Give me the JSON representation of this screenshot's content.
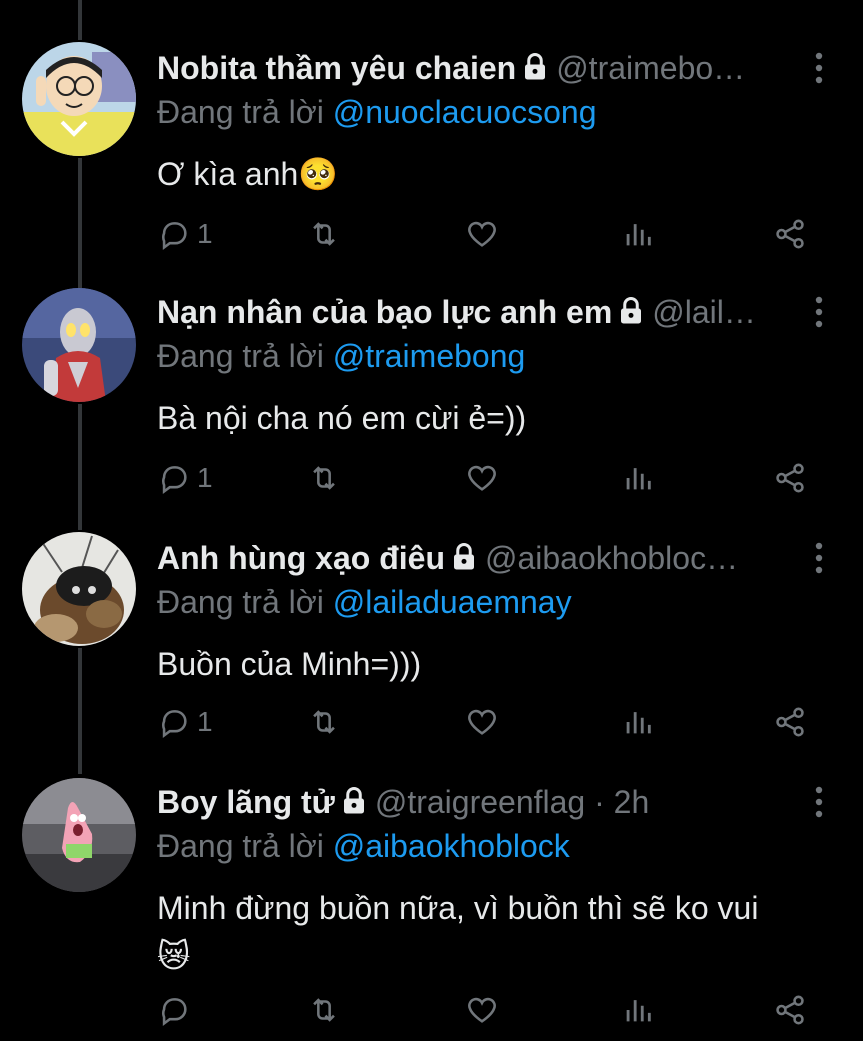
{
  "tweets": [
    {
      "name": "Nobita thầm yêu chaien",
      "handle": "@traimebo…",
      "reply_prefix": "Đang trả lời",
      "reply_to": "@nuoclacuocsong",
      "text": "Ơ kìa anh",
      "emoji": "🥺",
      "reply_count": "1",
      "avatar": "nobita-avatar"
    },
    {
      "name": "Nạn nhân của bạo lực anh em",
      "handle": "@lail…",
      "reply_prefix": "Đang trả lời",
      "reply_to": "@traimebong",
      "text": "Bà nội cha nó em cừi ẻ=))",
      "reply_count": "1",
      "avatar": "ultraman-avatar"
    },
    {
      "name": "Anh hùng xạo điêu",
      "handle": "@aibaokhobloc…",
      "reply_prefix": "Đang trả lời",
      "reply_to": "@lailaduaemnay",
      "text": "Buồn của Minh=)))",
      "reply_count": "1",
      "avatar": "dog-avatar"
    },
    {
      "name": "Boy lãng tử",
      "handle": "@traigreenflag · 2h",
      "reply_prefix": "Đang trả lời",
      "reply_to": "@aibaokhoblock",
      "text": "Minh đừng buồn nữa, vì buồn thì sẽ ko vui",
      "emoji": "😿",
      "reply_count": "",
      "avatar": "patrick-avatar"
    }
  ],
  "icons": {
    "reply": "reply-icon",
    "retweet": "retweet-icon",
    "like": "heart-icon",
    "views": "views-icon",
    "share": "share-icon",
    "lock": "lock-icon",
    "more": "more-icon"
  },
  "colors": {
    "background": "#000000",
    "text": "#e7e9ea",
    "muted": "#71767b",
    "link": "#1d9bf0"
  }
}
